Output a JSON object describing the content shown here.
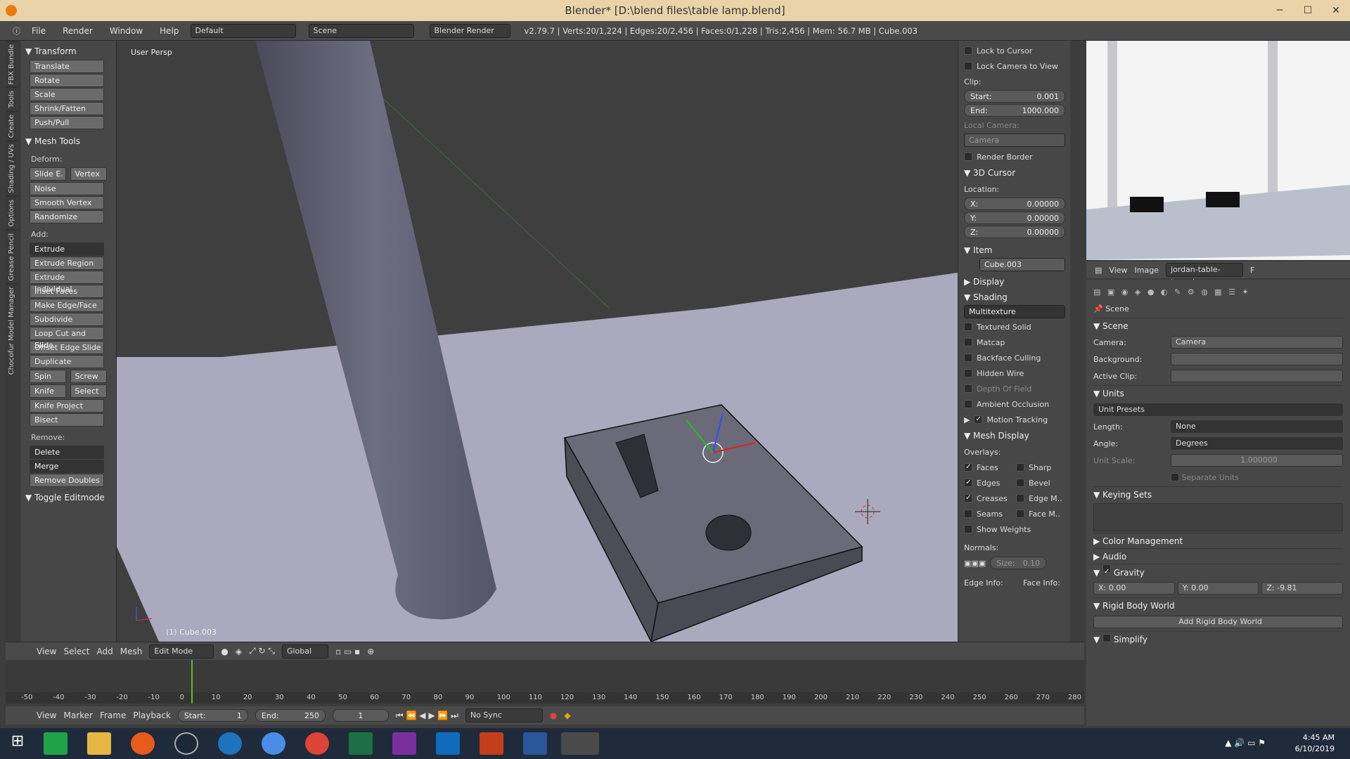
{
  "window": {
    "title": "Blender* [D:\\blend files\\table lamp.blend]"
  },
  "menubar": {
    "items": [
      "File",
      "Render",
      "Window",
      "Help"
    ],
    "layout": "Default",
    "scene": "Scene",
    "engine": "Blender Render",
    "stats": "v2.79.7 | Verts:20/1,224 | Edges:20/2,456 | Faces:0/1,228 | Tris:2,456 | Mem: 56.7 MB | Cube.003"
  },
  "left_tabs": [
    "FBX Bundle",
    "Tools",
    "Create",
    "Shading / UVs",
    "Options",
    "Grease Pencil",
    "Chocofur Model Manager"
  ],
  "toolshelf": {
    "transform_header": "Transform",
    "transform": [
      "Translate",
      "Rotate",
      "Scale",
      "Shrink/Fatten",
      "Push/Pull"
    ],
    "meshtools_header": "Mesh Tools",
    "deform_label": "Deform:",
    "slide_e": "Slide E.",
    "vertex": "Vertex",
    "deform": [
      "Noise",
      "Smooth Vertex",
      "Randomize"
    ],
    "add_label": "Add:",
    "extrude": "Extrude",
    "add": [
      "Extrude Region",
      "Extrude Individual",
      "Inset Faces",
      "Make Edge/Face",
      "Subdivide",
      "Loop Cut and Slide",
      "Offset Edge Slide",
      "Duplicate"
    ],
    "spin": "Spin",
    "screw": "Screw",
    "knife": "Knife",
    "select": "Select",
    "add2": [
      "Knife Project",
      "Bisect"
    ],
    "remove_label": "Remove:",
    "delete": "Delete",
    "merge": "Merge",
    "remove_doubles": "Remove Doubles",
    "toggle": "Toggle Editmode"
  },
  "viewport": {
    "persp": "User Persp",
    "object_label": "(1) Cube.003"
  },
  "npanel": {
    "lock_cursor": "Lock to Cursor",
    "lock_camera": "Lock Camera to View",
    "clip": "Clip:",
    "clip_start_lbl": "Start:",
    "clip_start": "0.001",
    "clip_end_lbl": "End:",
    "clip_end": "1000.000",
    "local_camera": "Local Camera:",
    "camera": "Camera",
    "render_border": "Render Border",
    "cursor_header": "3D Cursor",
    "location": "Location:",
    "x_lbl": "X:",
    "x": "0.00000",
    "y_lbl": "Y:",
    "y": "0.00000",
    "z_lbl": "Z:",
    "z": "0.00000",
    "item_header": "Item",
    "item_name": "Cube.003",
    "display_header": "Display",
    "shading_header": "Shading",
    "shading_mode": "Multitexture",
    "shading_opts": [
      "Textured Solid",
      "Matcap",
      "Backface Culling",
      "Hidden Wire",
      "Depth Of Field",
      "Ambient Occlusion"
    ],
    "motion_tracking": "Motion Tracking",
    "mesh_display": "Mesh Display",
    "overlays": "Overlays:",
    "ov_left": [
      "Faces",
      "Edges",
      "Creases",
      "Seams"
    ],
    "ov_right": [
      "Sharp",
      "Bevel",
      "Edge M..",
      "Face M.."
    ],
    "show_weights": "Show Weights",
    "normals": "Normals:",
    "size_lbl": "Size:",
    "size": "0.10",
    "edge_info": "Edge Info:",
    "face_info": "Face Info:"
  },
  "image_editor": {
    "view": "View",
    "image": "Image",
    "filename": "jordan-table-lamp.jpg",
    "f": "F"
  },
  "properties": {
    "breadcrumb": "Scene",
    "scene_header": "Scene",
    "camera_lbl": "Camera:",
    "camera": "Camera",
    "background_lbl": "Background:",
    "active_clip_lbl": "Active Clip:",
    "units_header": "Units",
    "unit_presets": "Unit Presets",
    "length_lbl": "Length:",
    "length": "None",
    "angle_lbl": "Angle:",
    "angle": "Degrees",
    "unit_scale_lbl": "Unit Scale:",
    "unit_scale": "1.000000",
    "separate_units": "Separate Units",
    "keying_header": "Keying Sets",
    "color_mgmt": "Color Management",
    "audio": "Audio",
    "gravity": "Gravity",
    "gx_lbl": "X:",
    "gx": "0.00",
    "gy_lbl": "Y:",
    "gy": "0.00",
    "gz_lbl": "Z:",
    "gz": "-9.81",
    "rigid_header": "Rigid Body World",
    "add_rigid": "Add Rigid Body World",
    "simplify": "Simplify"
  },
  "viewport_header": {
    "items": [
      "View",
      "Select",
      "Add",
      "Mesh"
    ],
    "mode": "Edit Mode",
    "orientation": "Global"
  },
  "timeline": {
    "ticks": [
      "-50",
      "-40",
      "-30",
      "-20",
      "-10",
      "0",
      "10",
      "20",
      "30",
      "40",
      "50",
      "60",
      "70",
      "80",
      "90",
      "100",
      "110",
      "120",
      "130",
      "140",
      "150",
      "160",
      "170",
      "180",
      "190",
      "200",
      "210",
      "220",
      "230",
      "240",
      "250",
      "260",
      "270",
      "280"
    ]
  },
  "timeline_header": {
    "items": [
      "View",
      "Marker",
      "Frame",
      "Playback"
    ],
    "start_lbl": "Start:",
    "start": "1",
    "end_lbl": "End:",
    "end": "250",
    "current": "1",
    "sync": "No Sync"
  },
  "taskbar": {
    "time": "4:45 AM",
    "date": "6/10/2019"
  }
}
